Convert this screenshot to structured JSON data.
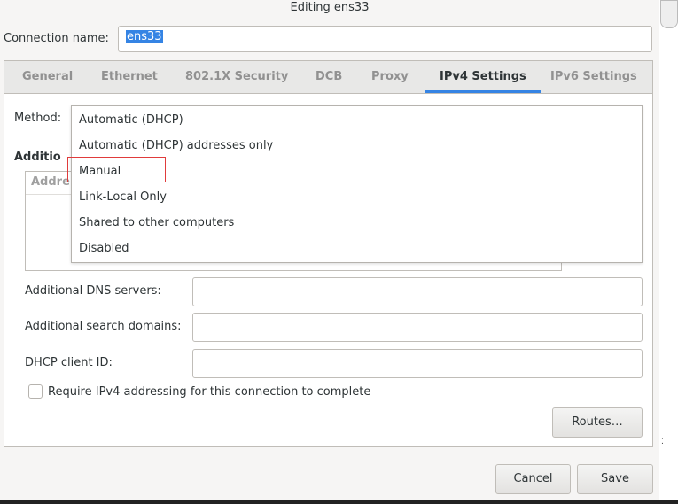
{
  "window": {
    "title": "Editing ens33"
  },
  "connection": {
    "label": "Connection name:",
    "value": "ens33"
  },
  "tabs": [
    {
      "label": "General"
    },
    {
      "label": "Ethernet"
    },
    {
      "label": "802.1X Security"
    },
    {
      "label": "DCB"
    },
    {
      "label": "Proxy"
    },
    {
      "label": "IPv4 Settings"
    },
    {
      "label": "IPv6 Settings"
    }
  ],
  "active_tab": "IPv4 Settings",
  "ipv4": {
    "method_label": "Method:",
    "method_options": [
      "Automatic (DHCP)",
      "Automatic (DHCP) addresses only",
      "Manual",
      "Link-Local Only",
      "Shared to other computers",
      "Disabled"
    ],
    "highlighted_option": "Manual",
    "additional_label": "Additio",
    "addresses_header": "Addre",
    "dns_label": "Additional DNS servers:",
    "dns_value": "",
    "search_label": "Additional search domains:",
    "search_value": "",
    "dhcp_label": "DHCP client ID:",
    "dhcp_value": "",
    "require_label": "Require IPv4 addressing for this connection to complete",
    "routes_button": "Routes…"
  },
  "footer": {
    "cancel_label": "Cancel",
    "save_label": "Save"
  },
  "colors": {
    "accent": "#3584e4",
    "highlight_border": "#e03b3b"
  }
}
